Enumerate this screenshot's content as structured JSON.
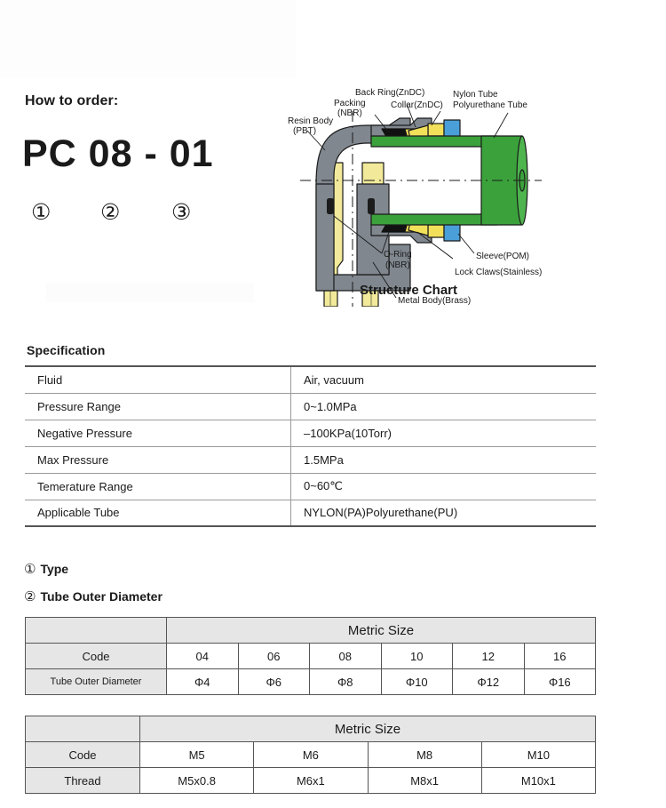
{
  "order": {
    "heading": "How to order:",
    "part_number": "PC 08 - 01",
    "markers": [
      "①",
      "②",
      "③"
    ]
  },
  "structure_chart": {
    "caption": "Structure Chart",
    "labels": {
      "resin_body": "Resin Body",
      "resin_body_sub": "(PBT)",
      "packing": "Packing",
      "packing_sub": "(NBR)",
      "back_ring": "Back Ring(ZnDC)",
      "collar": "Collar(ZnDC)",
      "nylon_tube": "Nylon Tube",
      "polyurethane_tube": "Polyurethane Tube",
      "sleeve": "Sleeve(POM)",
      "lock_claws": "Lock Claws(Stainless)",
      "o_ring": "O-Ring",
      "o_ring_sub": "(NBR)",
      "metal_body": "Metal Body(Brass)"
    },
    "colors": {
      "resin_gray": "#80878f",
      "brass_yellow": "#f2ea9a",
      "tube_green": "#3ba23b",
      "sleeve_blue": "#4a9fd8",
      "packing_black": "#111111",
      "outline": "#1a1a1a"
    }
  },
  "specification": {
    "heading": "Specification",
    "rows": [
      {
        "label": "Fluid",
        "value": "Air, vacuum"
      },
      {
        "label": "Pressure Range",
        "value": "0~1.0MPa"
      },
      {
        "label": "Negative Pressure",
        "value": "–100KPa(10Torr)"
      },
      {
        "label": "Max Pressure",
        "value": "1.5MPa"
      },
      {
        "label": "Temerature Range",
        "value": "0~60℃"
      },
      {
        "label": "Applicable Tube",
        "value": "NYLON(PA)Polyurethane(PU)"
      }
    ]
  },
  "type_section": {
    "marker": "①",
    "title": "Type"
  },
  "tube_section": {
    "marker": "②",
    "title": "Tube Outer Diameter",
    "span_header": "Metric Size",
    "code_label": "Code",
    "diameter_label": "Tube Outer Diameter",
    "codes": [
      "04",
      "06",
      "08",
      "10",
      "12",
      "16"
    ],
    "diameters": [
      "Φ4",
      "Φ6",
      "Φ8",
      "Φ10",
      "Φ12",
      "Φ16"
    ]
  },
  "thread_section": {
    "span_header": "Metric Size",
    "code_label": "Code",
    "thread_label": "Thread",
    "codes": [
      "M5",
      "M6",
      "M8",
      "M10"
    ],
    "threads": [
      "M5x0.8",
      "M6x1",
      "M8x1",
      "M10x1"
    ]
  }
}
